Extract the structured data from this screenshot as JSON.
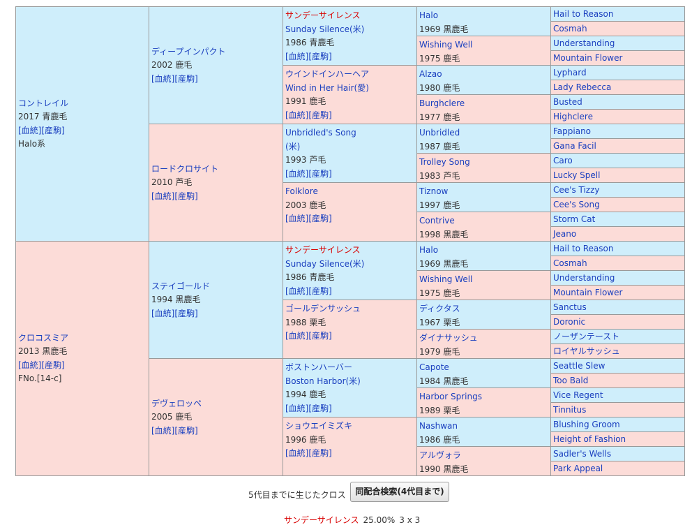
{
  "horse": {
    "name": "コントレイル",
    "year_coat": "2017 青鹿毛",
    "links": "[血統][産駒]",
    "line": "Halo系",
    "sire": {
      "name": "ディープインパクト",
      "year_coat": "2002 鹿毛",
      "links": "[血統][産駒]",
      "sire": {
        "name": "サンデーサイレンス",
        "eng": "Sunday Silence(米)",
        "year_coat": "1986 青鹿毛",
        "links": "[血統][産駒]",
        "sire": {
          "name": "Halo",
          "year_coat": "1969 黒鹿毛",
          "sire": "Hail to Reason",
          "dam": "Cosmah"
        },
        "dam": {
          "name": "Wishing Well",
          "year_coat": "1975 鹿毛",
          "sire": "Understanding",
          "dam": "Mountain Flower"
        }
      },
      "dam": {
        "name": "ウインドインハーヘア",
        "eng": "Wind in Her Hair(愛)",
        "year_coat": "1991 鹿毛",
        "links": "[血統][産駒]",
        "sire": {
          "name": "Alzao",
          "year_coat": "1980 鹿毛",
          "sire": "Lyphard",
          "dam": "Lady Rebecca"
        },
        "dam": {
          "name": "Burghclere",
          "year_coat": "1977 鹿毛",
          "sire": "Busted",
          "dam": "Highclere"
        }
      }
    },
    "dam": {
      "name": "ロードクロサイト",
      "year_coat": "2010 芦毛",
      "links": "[血統][産駒]",
      "sire": {
        "name": "Unbridled's Song",
        "eng": "(米)",
        "year_coat": "1993 芦毛",
        "links": "[血統][産駒]",
        "sire": {
          "name": "Unbridled",
          "year_coat": "1987 鹿毛",
          "sire": "Fappiano",
          "dam": "Gana Facil"
        },
        "dam": {
          "name": "Trolley Song",
          "year_coat": "1983 芦毛",
          "sire": "Caro",
          "dam": "Lucky Spell"
        }
      },
      "dam": {
        "name": "Folklore",
        "year_coat": "2003 鹿毛",
        "links": "[血統][産駒]",
        "sire": {
          "name": "Tiznow",
          "year_coat": "1997 鹿毛",
          "sire": "Cee's Tizzy",
          "dam": "Cee's Song"
        },
        "dam": {
          "name": "Contrive",
          "year_coat": "1998 黒鹿毛",
          "sire": "Storm Cat",
          "dam": "Jeano"
        }
      }
    }
  },
  "damside": {
    "name": "クロコスミア",
    "year_coat": "2013 黒鹿毛",
    "links": "[血統][産駒]",
    "family": "FNo.[14-c]",
    "sire": {
      "name": "ステイゴールド",
      "year_coat": "1994 黒鹿毛",
      "links": "[血統][産駒]",
      "sire": {
        "name": "サンデーサイレンス",
        "eng": "Sunday Silence(米)",
        "year_coat": "1986 青鹿毛",
        "links": "[血統][産駒]",
        "sire": {
          "name": "Halo",
          "year_coat": "1969 黒鹿毛",
          "sire": "Hail to Reason",
          "dam": "Cosmah"
        },
        "dam": {
          "name": "Wishing Well",
          "year_coat": "1975 鹿毛",
          "sire": "Understanding",
          "dam": "Mountain Flower"
        }
      },
      "dam": {
        "name": "ゴールデンサッシュ",
        "year_coat": "1988 栗毛",
        "links": "[血統][産駒]",
        "sire": {
          "name": "ディクタス",
          "year_coat": "1967 栗毛",
          "sire": "Sanctus",
          "dam": "Doronic"
        },
        "dam": {
          "name": "ダイナサッシュ",
          "year_coat": "1979 鹿毛",
          "sire": "ノーザンテースト",
          "dam": "ロイヤルサッシュ"
        }
      }
    },
    "dam": {
      "name": "デヴェロッペ",
      "year_coat": "2005 鹿毛",
      "links": "[血統][産駒]",
      "sire": {
        "name": "ボストンハーバー",
        "eng": "Boston Harbor(米)",
        "year_coat": "1994 鹿毛",
        "links": "[血統][産駒]",
        "sire": {
          "name": "Capote",
          "year_coat": "1984 黒鹿毛",
          "sire": "Seattle Slew",
          "dam": "Too Bald"
        },
        "dam": {
          "name": "Harbor Springs",
          "year_coat": "1989 栗毛",
          "sire": "Vice Regent",
          "dam": "Tinnitus"
        }
      },
      "dam": {
        "name": "ショウエイミズキ",
        "year_coat": "1996 鹿毛",
        "links": "[血統][産駒]",
        "sire": {
          "name": "Nashwan",
          "year_coat": "1986 鹿毛",
          "sire": "Blushing Groom",
          "dam": "Height of Fashion"
        },
        "dam": {
          "name": "アルヴォラ",
          "year_coat": "1990 黒鹿毛",
          "sire": "Sadler's Wells",
          "dam": "Park Appeal"
        }
      }
    }
  },
  "footer": {
    "cross_label": "5代目までに生じたクロス",
    "search_button": "同配合検索(4代目まで)",
    "cross_horse": "サンデーサイレンス",
    "cross_pct": "25.00%",
    "cross_gen": "3 x 3"
  },
  "colors": {
    "male_bg": "#cfeefb",
    "female_bg": "#fcdcd8",
    "link": "#1a3fbf",
    "highlight": "#d90000"
  }
}
